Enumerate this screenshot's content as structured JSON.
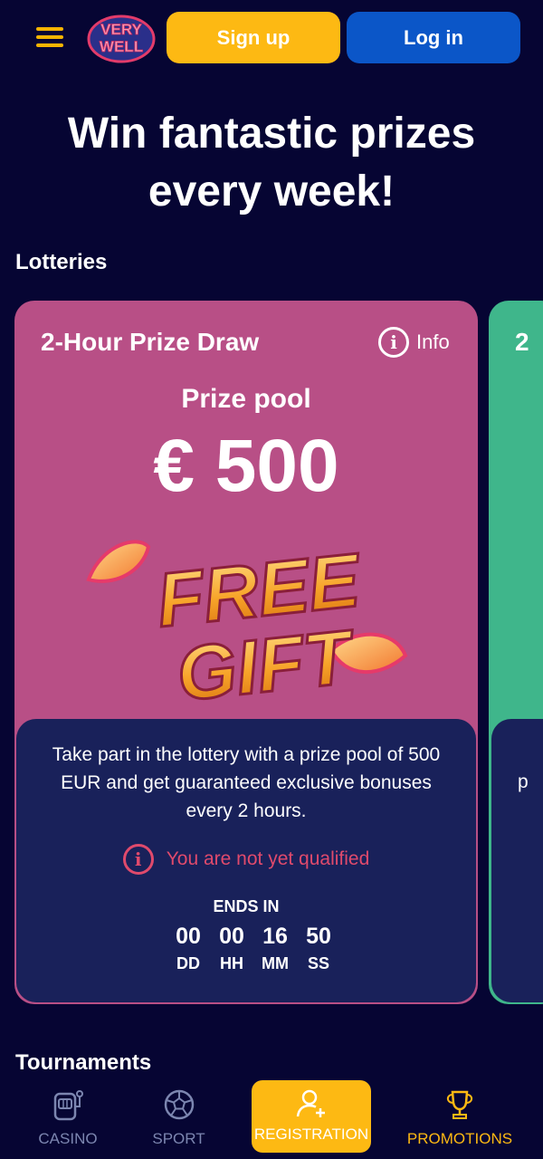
{
  "header": {
    "logo_text_line1": "VERY",
    "logo_text_line2": "WELL",
    "signup_label": "Sign up",
    "login_label": "Log in"
  },
  "hero": {
    "title_line1": "Win fantastic prizes",
    "title_line2": "every week!"
  },
  "sections": {
    "lotteries": "Lotteries",
    "tournaments": "Tournaments"
  },
  "lottery": {
    "title": "2-Hour Prize Draw",
    "info_label": "Info",
    "pool_label": "Prize pool",
    "pool_value": "€ 500",
    "gift_line1": "FREE",
    "gift_line2": "GIFT",
    "description": "Take part in the lottery with a prize pool of 500 EUR and get guaranteed exclusive bonuses every 2 hours.",
    "qualify_text": "You are not yet qualified",
    "ends_label": "ENDS IN",
    "timer": [
      {
        "value": "00",
        "unit": "DD"
      },
      {
        "value": "00",
        "unit": "HH"
      },
      {
        "value": "16",
        "unit": "MM"
      },
      {
        "value": "50",
        "unit": "SS"
      }
    ]
  },
  "lottery2": {
    "title_fragment": "2",
    "text_fragment": "p"
  },
  "bottom_nav": {
    "casino": "CASINO",
    "sport": "SPORT",
    "registration": "REGISTRATION",
    "promotions": "PROMOTIONS"
  },
  "colors": {
    "background": "#060533",
    "accent_yellow": "#fdb913",
    "login_blue": "#0b56c8",
    "card_pink": "#b84f86",
    "card_green": "#3fb68b",
    "card_panel": "#19215a",
    "warning_red": "#e04a6c"
  }
}
